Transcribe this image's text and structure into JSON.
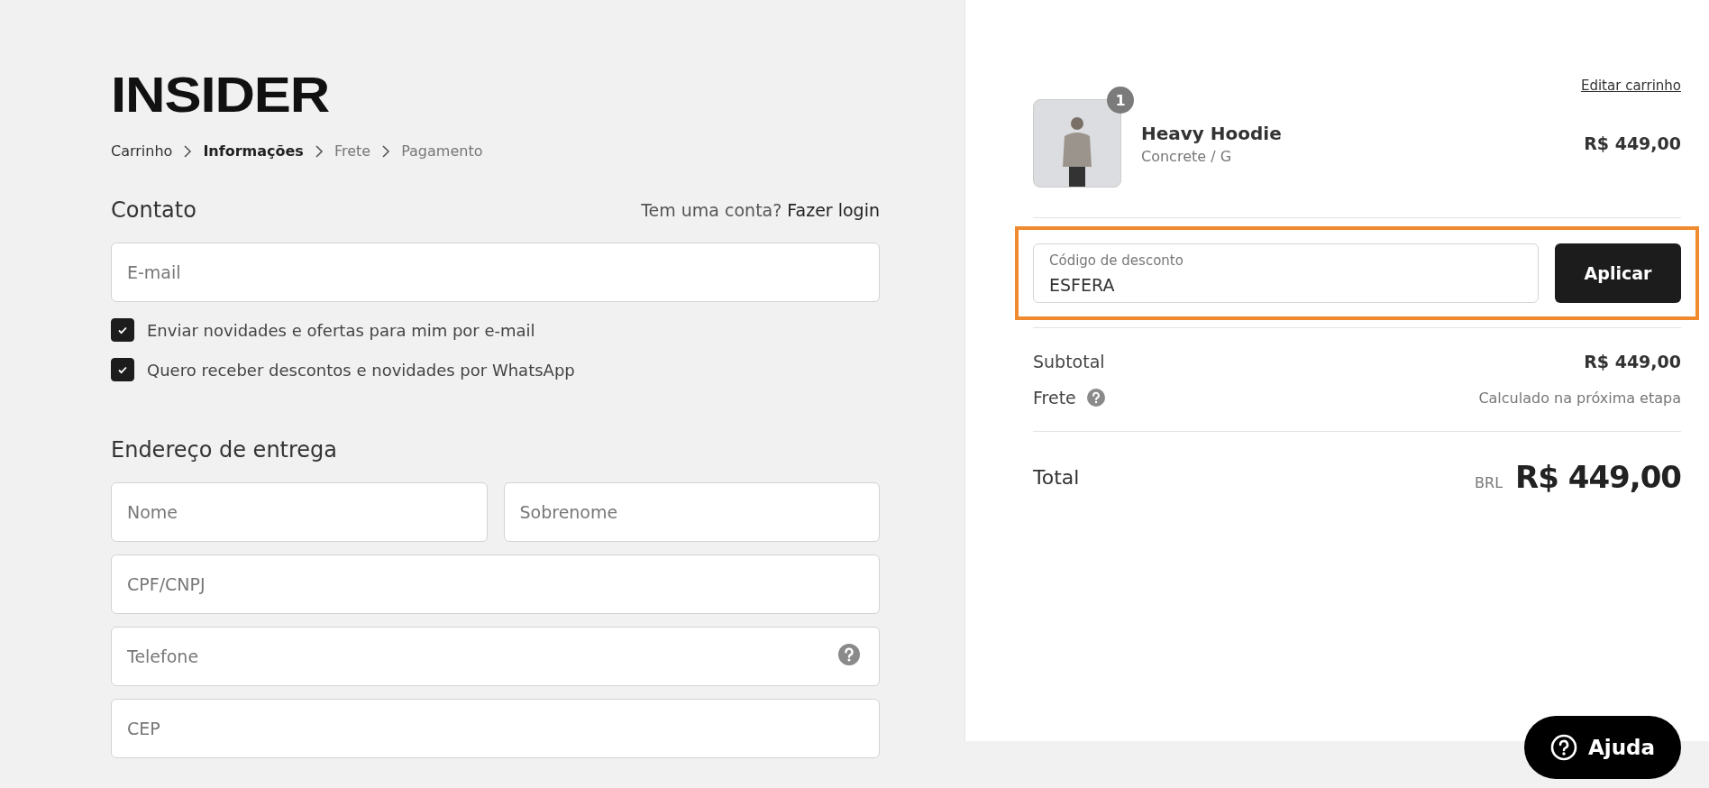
{
  "logo": "INSIDER",
  "breadcrumb": [
    {
      "label": "Carrinho",
      "selected": false,
      "visited": true
    },
    {
      "label": "Informações",
      "selected": true,
      "visited": false
    },
    {
      "label": "Frete",
      "selected": false,
      "visited": false
    },
    {
      "label": "Pagamento",
      "selected": false,
      "visited": false
    }
  ],
  "contact": {
    "title": "Contato",
    "login_prompt": "Tem uma conta?",
    "login_link": "Fazer login",
    "email": {
      "placeholder": "E-mail"
    },
    "options": [
      {
        "label": "Enviar novidades e ofertas para mim por e-mail",
        "checked": true
      },
      {
        "label": "Quero receber descontos e novidades por WhatsApp",
        "checked": true
      }
    ]
  },
  "address": {
    "title": "Endereço de entrega",
    "fields": [
      {
        "placeholder": "Nome",
        "half": true,
        "help": false
      },
      {
        "placeholder": "Sobrenome",
        "half": true,
        "help": false
      },
      {
        "placeholder": "CPF/CNPJ",
        "half": false,
        "help": false
      },
      {
        "placeholder": "Telefone",
        "half": false,
        "help": true
      },
      {
        "placeholder": "CEP",
        "half": false,
        "help": false
      }
    ]
  },
  "summary": {
    "edit_link": "Editar carrinho",
    "items": [
      {
        "quantity": "1",
        "name": "Heavy Hoodie",
        "variant": "Concrete / G",
        "price": "R$ 449,00"
      }
    ],
    "discount": {
      "label": "Código de desconto",
      "value": "ESFERA",
      "button": "Aplicar",
      "highlighted": true
    },
    "lines": [
      {
        "label": "Subtotal",
        "value": "R$ 449,00",
        "kind": "amount",
        "help": false
      },
      {
        "label": "Frete",
        "value": "Calculado na próxima etapa",
        "kind": "note",
        "help": true
      }
    ],
    "total": {
      "label": "Total",
      "currency": "BRL",
      "value": "R$ 449,00"
    }
  },
  "help_button": "Ajuda"
}
